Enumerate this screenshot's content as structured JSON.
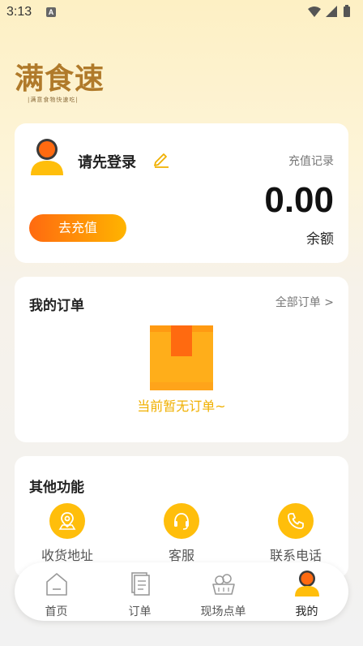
{
  "status_bar": {
    "time": "3:13",
    "notification_badge": "A"
  },
  "logo": {
    "title": "满食速",
    "subtitle": "|满意食物快速吃|"
  },
  "user_card": {
    "login_prompt": "请先登录",
    "recharge_record": "充值记录",
    "balance": "0.00",
    "balance_label": "余额",
    "recharge_button": "去充值"
  },
  "orders": {
    "title": "我的订单",
    "all_orders": "全部订单 >",
    "empty_text": "当前暂无订单~"
  },
  "other": {
    "title": "其他功能",
    "items": [
      {
        "label": "收货地址",
        "icon": "location-icon"
      },
      {
        "label": "客服",
        "icon": "headset-icon"
      },
      {
        "label": "联系电话",
        "icon": "phone-icon"
      }
    ]
  },
  "tabbar": {
    "items": [
      {
        "label": "首页",
        "icon": "home-icon",
        "active": false
      },
      {
        "label": "订单",
        "icon": "orders-icon",
        "active": false
      },
      {
        "label": "现场点单",
        "icon": "food-basket-icon",
        "active": false
      },
      {
        "label": "我的",
        "icon": "profile-icon",
        "active": true
      }
    ]
  },
  "colors": {
    "accent": "#ffbe0b",
    "gradient_start": "#ff6a10",
    "gradient_end": "#ffb400",
    "logo": "#b07a2a",
    "empty_text": "#f0b000"
  }
}
